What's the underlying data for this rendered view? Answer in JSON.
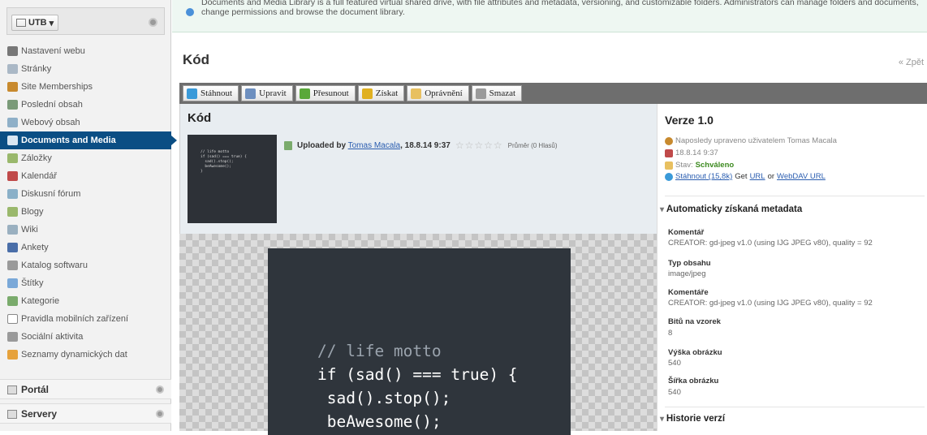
{
  "sidebar": {
    "site_label": "UTB",
    "items": [
      {
        "label": "Nastavení webu",
        "icon": "settings-icon",
        "color": "#777"
      },
      {
        "label": "Stránky",
        "icon": "pages-icon",
        "color": "#aab8c6"
      },
      {
        "label": "Site Memberships",
        "icon": "users-icon",
        "color": "#c88a2e"
      },
      {
        "label": "Poslední obsah",
        "icon": "recent-content-icon",
        "color": "#7a9a78"
      },
      {
        "label": "Webový obsah",
        "icon": "web-content-icon",
        "color": "#8fb0c8"
      },
      {
        "label": "Documents and Media",
        "icon": "folder-icon",
        "color": "#d9e6f2"
      },
      {
        "label": "Záložky",
        "icon": "bookmarks-icon",
        "color": "#9ab86c"
      },
      {
        "label": "Kalendář",
        "icon": "calendar-icon",
        "color": "#c04a4a"
      },
      {
        "label": "Diskusní fórum",
        "icon": "forum-icon",
        "color": "#8ab0c8"
      },
      {
        "label": "Blogy",
        "icon": "blogs-icon",
        "color": "#9ab86c"
      },
      {
        "label": "Wiki",
        "icon": "wiki-icon",
        "color": "#9ab0c0"
      },
      {
        "label": "Ankety",
        "icon": "polls-icon",
        "color": "#4a6ea8"
      },
      {
        "label": "Katalog softwaru",
        "icon": "software-catalog-icon",
        "color": "#9a9a9a"
      },
      {
        "label": "Štítky",
        "icon": "tags-icon",
        "color": "#7aa8d8"
      },
      {
        "label": "Kategorie",
        "icon": "categories-icon",
        "color": "#7aab6c"
      },
      {
        "label": "Pravidla mobilních zařízení",
        "icon": "mobile-rules-icon",
        "color": "#ffffff"
      },
      {
        "label": "Sociální aktivita",
        "icon": "social-activity-icon",
        "color": "#9a9a9a"
      },
      {
        "label": "Seznamy dynamických dat",
        "icon": "dynamic-data-icon",
        "color": "#e6a23c"
      }
    ],
    "sections": {
      "portal": "Portál",
      "servers": "Servery"
    }
  },
  "info_text": "Documents and Media Library is a full featured virtual shared drive, with file attributes and metadata, versioning, and customizable folders. Administrators can manage folders and documents, change permissions and browse the document library.",
  "page": {
    "title": "Kód",
    "back_link": "« Zpět"
  },
  "toolbar": [
    {
      "label": "Stáhnout",
      "icon": "download-icon",
      "color": "#3a9ad9"
    },
    {
      "label": "Upravit",
      "icon": "edit-icon",
      "color": "#6d8fbf"
    },
    {
      "label": "Přesunout",
      "icon": "move-icon",
      "color": "#5aa83a"
    },
    {
      "label": "Získat",
      "icon": "lock-icon",
      "color": "#e0b020"
    },
    {
      "label": "Oprávnění",
      "icon": "permissions-icon",
      "color": "#e8c060"
    },
    {
      "label": "Smazat",
      "icon": "trash-icon",
      "color": "#9a9a9a"
    }
  ],
  "document": {
    "title": "Kód",
    "thumbnail_code": "// life motto\nif (sad() === true) {\n  sad().stop();\n  beAwesome();\n}",
    "uploaded_prefix": "Uploaded by",
    "uploader": "Tomas Macala",
    "date": "18.8.14 9:37",
    "rating": "Průměr (0 Hlasů)",
    "preview_comment": "// life motto",
    "preview_lines": [
      "if (sad() === true) {",
      " sad().stop();",
      " beAwesome();"
    ]
  },
  "version": {
    "title": "Verze 1.0",
    "last_modified": "Naposledy upraveno uživatelem Tomas Macala",
    "date": "18.8.14 9:37",
    "status_prefix": "Stav:",
    "status": "Schváleno",
    "download_link": "Stáhnout (15,8k)",
    "get_label": "Get",
    "url_link": "URL",
    "or_label": "or",
    "webdav_link": "WebDAV URL"
  },
  "metadata": {
    "section_title": "Automaticky získaná metadata",
    "fields": [
      {
        "label": "Komentář",
        "value": "CREATOR: gd-jpeg v1.0 (using IJG JPEG v80), quality = 92"
      },
      {
        "label": "Typ obsahu",
        "value": "image/jpeg"
      },
      {
        "label": "Komentáře",
        "value": "CREATOR: gd-jpeg v1.0 (using IJG JPEG v80), quality = 92"
      },
      {
        "label": "Bitů na vzorek",
        "value": "8"
      },
      {
        "label": "Výška obrázku",
        "value": "540"
      },
      {
        "label": "Šířka obrázku",
        "value": "540"
      }
    ]
  },
  "history": {
    "section_title": "Historie verzí"
  }
}
